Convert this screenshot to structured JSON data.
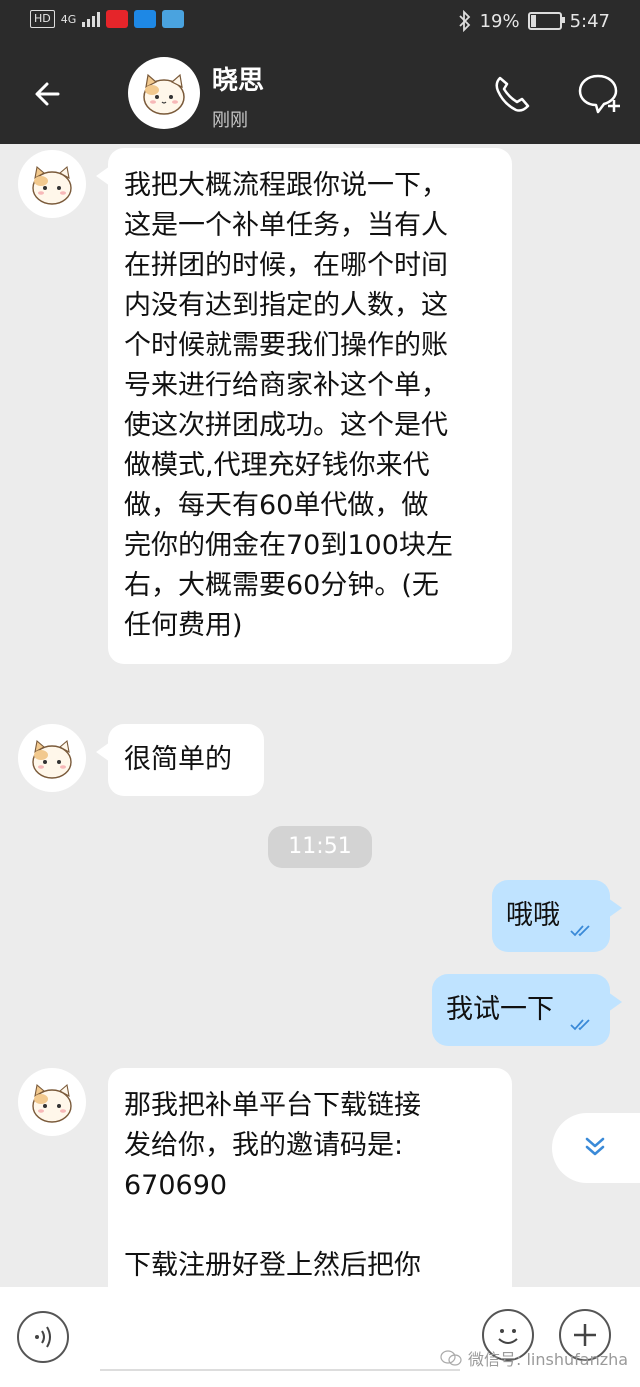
{
  "status_bar": {
    "hd_badge": "HD",
    "network": "4G",
    "battery_percent": "19%",
    "battery_level": 0.19,
    "time": "5:47",
    "icons": [
      "bluetooth-icon",
      "battery-icon",
      "signal-icon"
    ]
  },
  "header": {
    "contact_name": "晓思",
    "contact_status": "刚刚",
    "icons": [
      "back-arrow-icon",
      "phone-icon",
      "message-plus-icon"
    ]
  },
  "messages": [
    {
      "side": "left",
      "text": "我把大概流程跟你说一下，\n这是一个补单任务，当有人\n在拼团的时候，在哪个时间\n内没有达到指定的人数，这\n个时候就需要我们操作的账\n号来进行给商家补这个单，\n使这次拼团成功。这个是代\n做模式,代理充好钱你来代\n做，每天有60单代做，做\n完你的佣金在70到100块左\n右，大概需要60分钟。(无\n任何费用)"
    },
    {
      "side": "left",
      "text": "很简单的"
    },
    {
      "type": "timestamp",
      "text": "11:51"
    },
    {
      "side": "right",
      "text": "哦哦",
      "read": true
    },
    {
      "side": "right",
      "text": "我试一下",
      "read": true
    },
    {
      "side": "left",
      "text": "那我把补单平台下载链接\n发给你，我的邀请码是:\n670690\n\n下载注册好登上然后把你"
    }
  ],
  "input_bar": {
    "icons": [
      "voice-icon",
      "emoji-icon",
      "plus-icon"
    ]
  },
  "watermark": {
    "text": "微信号: linshufanzha"
  },
  "colors": {
    "header_bg": "#2b2b2b",
    "chat_bg": "#ececec",
    "outgoing_bubble": "#bfe3ff",
    "incoming_bubble": "#ffffff",
    "read_tick": "#3a8ad8"
  }
}
